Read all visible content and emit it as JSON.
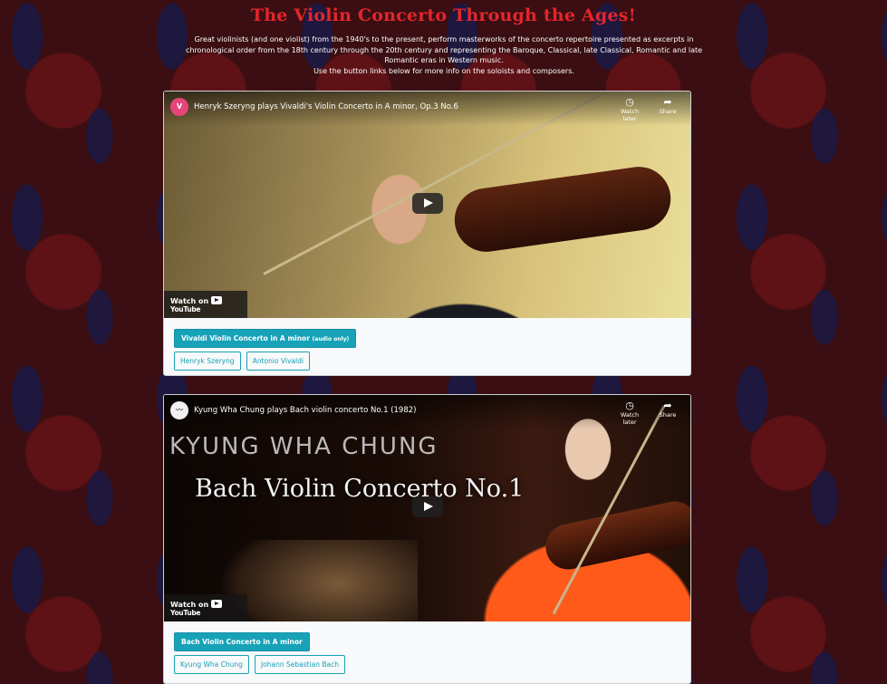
{
  "header": {
    "title": "The Violin Concerto Through the Ages!",
    "intro_line1": "Great violinists (and one violist) from the 1940's to the present, perform masterworks of the concerto repertoire presented as excerpts in chronological order from the 18th century through the 20th century and representing the Baroque, Classical, late Classical, Romantic and late Romantic eras in Western music.",
    "intro_line2": "Use the button links below for more info on the soloists and composers."
  },
  "player": {
    "watch_later": "Watch later",
    "share": "Share",
    "watch_on": "Watch on",
    "youtube": "YouTube"
  },
  "cards": [
    {
      "channel_initial": "V",
      "video_title": "Henryk Szeryng plays Vivaldi's Violin Concerto in A minor, Op.3 No.6",
      "main_button": "Vivaldi Violin Concerto in A minor",
      "main_button_note": "(audio only)",
      "soloist": "Henryk Szeryng",
      "composer": "Antonio Vivaldi"
    },
    {
      "channel_initial": "",
      "video_title": "Kyung Wha Chung plays Bach violin concerto No.1 (1982)",
      "overlay_name": "KYUNG WHA CHUNG",
      "overlay_work": "Bach Violin Concerto No.1",
      "main_button": "Bach Violin Concerto in A minor",
      "soloist": "Kyung Wha Chung",
      "composer": "Johann Sebastian Bach"
    }
  ],
  "colors": {
    "title": "#e3262b",
    "button": "#17a2b8",
    "background": "#3a0e12"
  }
}
